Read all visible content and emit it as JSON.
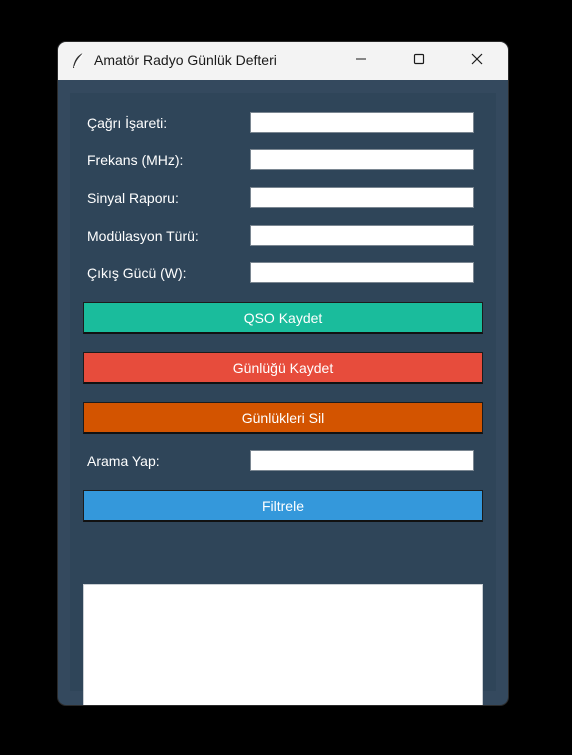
{
  "window": {
    "title": "Amatör Radyo Günlük Defteri",
    "app_icon": "feather-icon",
    "controls": [
      "minimize-icon",
      "maximize-icon",
      "close-icon"
    ]
  },
  "form": {
    "callsign_label": "Çağrı İşareti:",
    "callsign_value": "",
    "frequency_label": "Frekans (MHz):",
    "frequency_value": "",
    "signal_label": "Sinyal Raporu:",
    "signal_value": "",
    "mode_label": "Modülasyon Türü:",
    "mode_value": "",
    "power_label": "Çıkış Gücü (W):",
    "power_value": ""
  },
  "buttons": {
    "save_qso": "QSO Kaydet",
    "save_log": "Günlüğü Kaydet",
    "delete_logs": "Günlükleri Sil",
    "filter": "Filtrele"
  },
  "search": {
    "label": "Arama Yap:",
    "value": ""
  },
  "colors": {
    "window_bg": "#34495e",
    "save_qso_bg": "#1abc9c",
    "save_log_bg": "#e74c3c",
    "delete_logs_bg": "#d35400",
    "filter_bg": "#3498db"
  }
}
